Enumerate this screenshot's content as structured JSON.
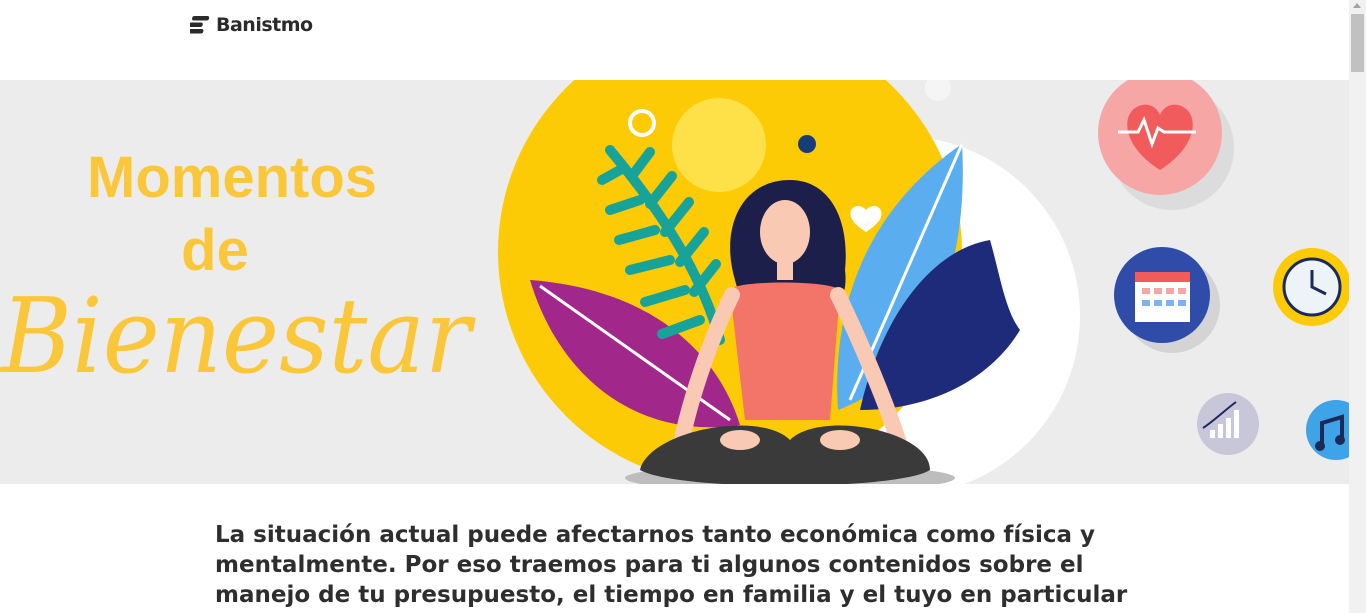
{
  "header": {
    "logo_text": "Banistmo",
    "logo_icon": "banistmo-logo-icon"
  },
  "hero": {
    "title_line1": "Momentos",
    "title_line2": "de",
    "title_script": "Bienestar",
    "title_color": "#fbc73a",
    "icons": [
      "heart-pulse-icon",
      "calendar-icon",
      "clock-icon",
      "growth-chart-icon",
      "music-note-icon"
    ]
  },
  "intro": {
    "text": "La situación actual puede afectarnos tanto económica como física y mentalmente. Por eso traemos para ti algunos contenidos sobre el manejo de tu presupuesto, el tiempo en familia y el tuyo en particular que te"
  },
  "colors": {
    "background": "#ececec",
    "yellow": "#fccb06",
    "text": "#2e2e2e"
  }
}
